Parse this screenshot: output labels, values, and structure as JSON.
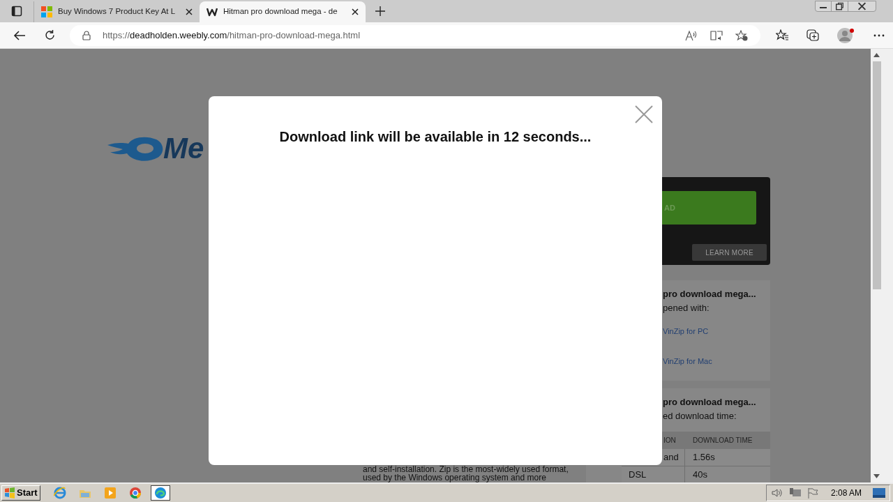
{
  "browser": {
    "tabs": [
      {
        "title": "Buy Windows 7 Product Key At L",
        "selected": false
      },
      {
        "title": "Hitman pro download mega - de",
        "selected": true
      }
    ],
    "url": {
      "scheme": "https://",
      "host": "deadholden.weebly.com",
      "path": "/hitman-pro-download-mega.html"
    }
  },
  "page": {
    "logo_text": "Me",
    "download_button": "AD",
    "learn_more": "LEARN MORE",
    "file_info": {
      "title": "pro download mega...",
      "subtitle": "pened with:",
      "links": [
        "VinZip for PC",
        "VinZip for Mac"
      ]
    },
    "download_time": {
      "title": "pro download mega...",
      "subtitle": "ed download time:",
      "columns": [
        "ION",
        "DOWNLOAD TIME"
      ],
      "rows": [
        [
          "and",
          "1.56s"
        ],
        [
          "DSL",
          "40s"
        ]
      ]
    },
    "description": [
      "and self-installation. Zip is the most-widely used format,",
      "used by the Windows operating system and more"
    ]
  },
  "modal": {
    "message": "Download link will be available in 12 seconds..."
  },
  "taskbar": {
    "start": "Start",
    "apps": [
      {
        "kind": "ie",
        "selected": false
      },
      {
        "kind": "folder",
        "selected": false
      },
      {
        "kind": "media",
        "selected": false
      },
      {
        "kind": "chrome",
        "selected": false
      },
      {
        "kind": "edge",
        "selected": true
      }
    ],
    "clock": "2:08 AM"
  }
}
